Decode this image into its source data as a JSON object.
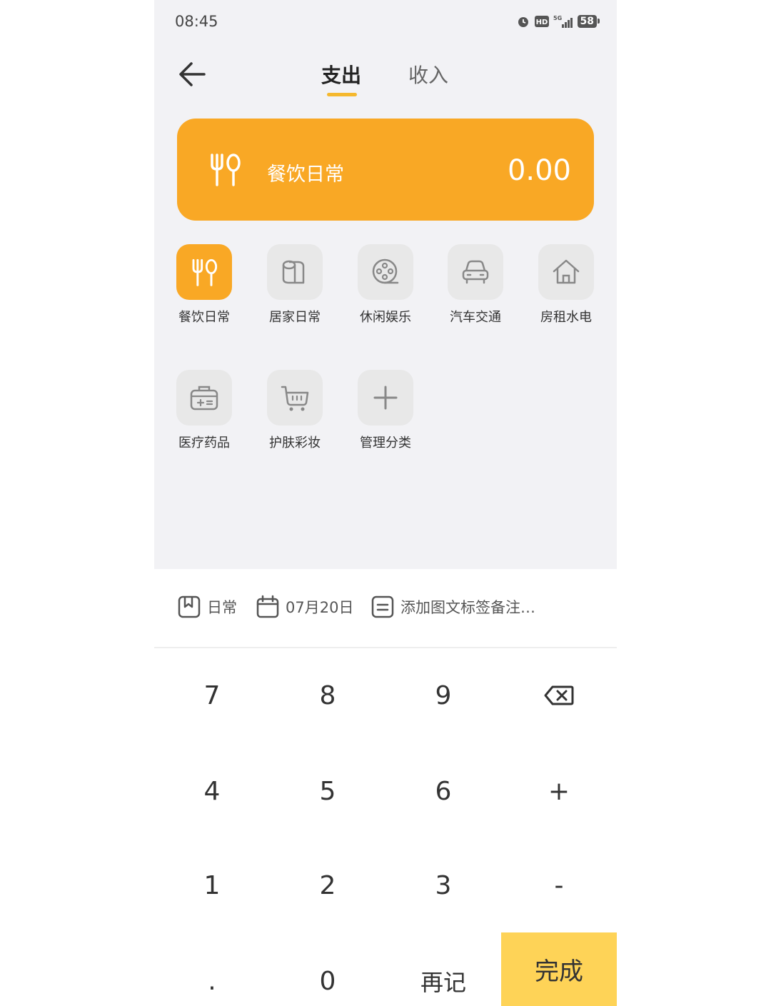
{
  "status_bar": {
    "time": "08:45",
    "battery": "58"
  },
  "tabs": {
    "expense": "支出",
    "income": "收入"
  },
  "amount_card": {
    "category": "餐饮日常",
    "amount": "0.00"
  },
  "categories": [
    {
      "label": "餐饮日常",
      "icon": "utensils-icon"
    },
    {
      "label": "居家日常",
      "icon": "toilet-paper-icon"
    },
    {
      "label": "休闲娱乐",
      "icon": "film-reel-icon"
    },
    {
      "label": "汽车交通",
      "icon": "car-icon"
    },
    {
      "label": "房租水电",
      "icon": "house-icon"
    },
    {
      "label": "医疗药品",
      "icon": "medical-kit-icon"
    },
    {
      "label": "护肤彩妆",
      "icon": "shopping-cart-icon"
    },
    {
      "label": "管理分类",
      "icon": "plus-icon"
    }
  ],
  "tools": {
    "book": "日常",
    "date": "07月20日",
    "note": "添加图文标签备注…"
  },
  "keypad": {
    "k7": "7",
    "k8": "8",
    "k9": "9",
    "k4": "4",
    "k5": "5",
    "k6": "6",
    "plus": "+",
    "k1": "1",
    "k2": "2",
    "k3": "3",
    "minus": "-",
    "dot": ".",
    "k0": "0",
    "again": "再记",
    "done": "完成"
  },
  "colors": {
    "accent": "#f9a825",
    "done_button": "#fed357",
    "background": "#f2f2f5"
  }
}
